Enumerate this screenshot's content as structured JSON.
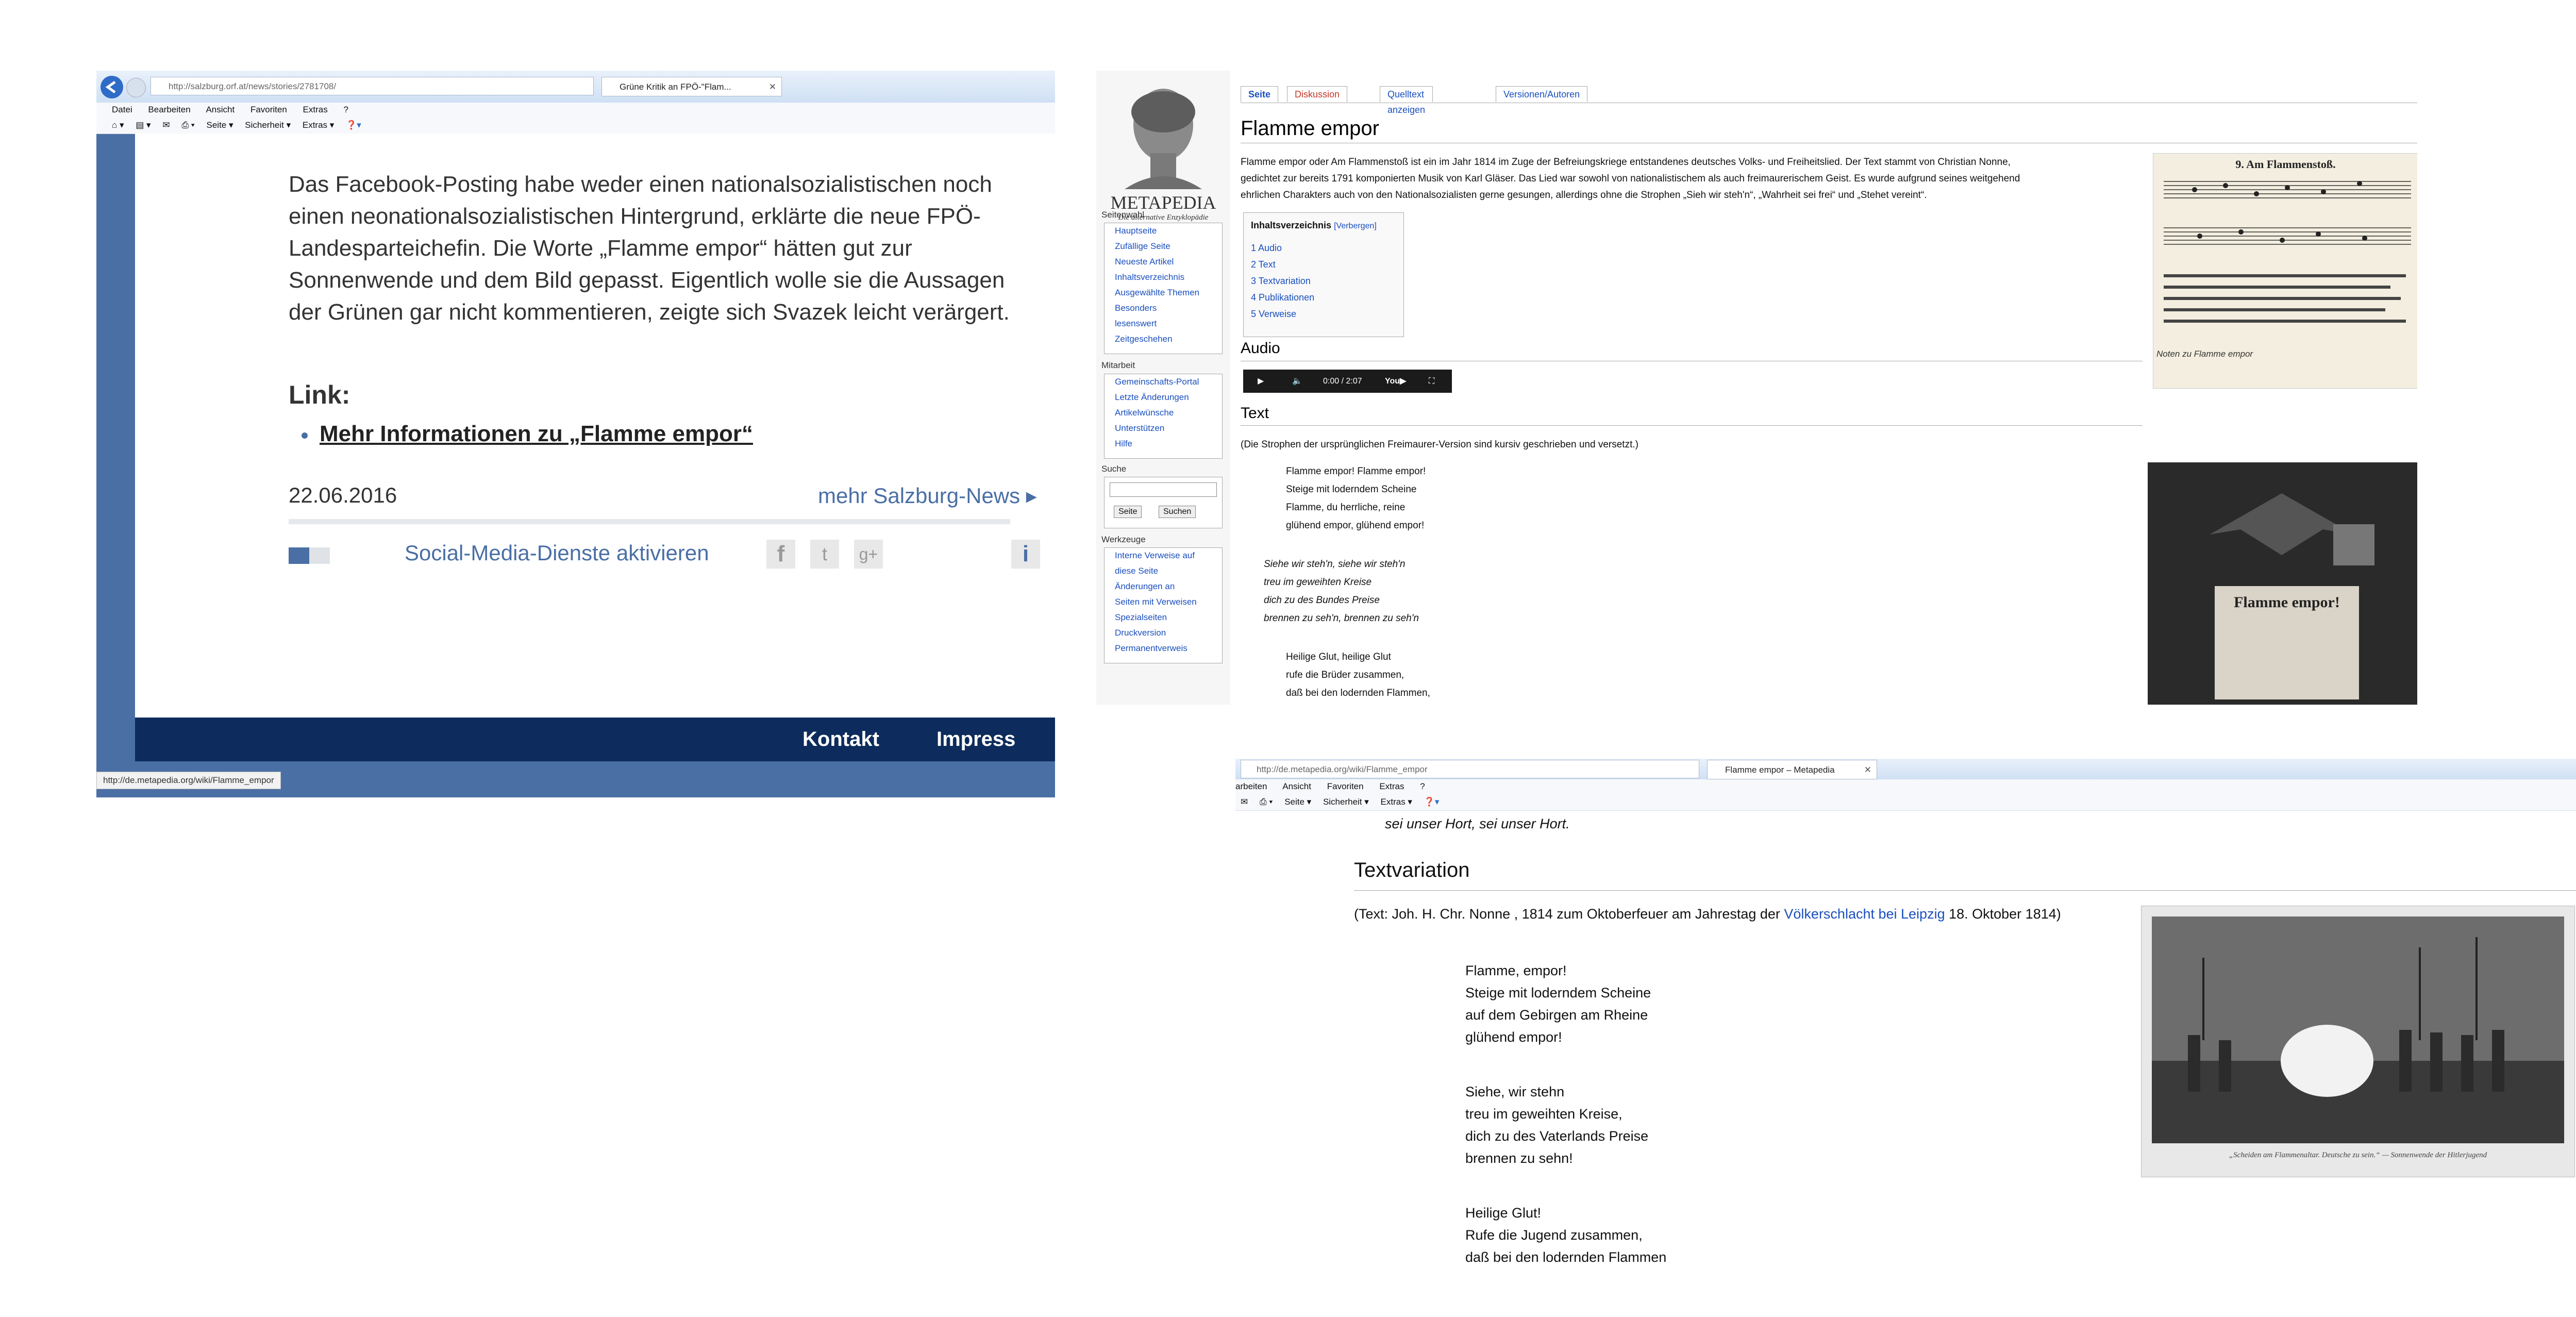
{
  "orf": {
    "url": "http://salzburg.orf.at/news/stories/2781708/",
    "tab_title": "Grüne Kritik an FPÖ-\"Flam...",
    "menu": [
      "Datei",
      "Bearbeiten",
      "Ansicht",
      "Favoriten",
      "Extras",
      "?"
    ],
    "commands": [
      "Seite ▾",
      "Sicherheit ▾",
      "Extras ▾"
    ],
    "paragraph": "Das Facebook-Posting habe weder einen nationalsozialistischen noch einen neonationalsozialistischen Hintergrund, erklärte die neue FPÖ-Landesparteichefin. Die Worte „Flamme empor“ hätten gut zur Sonnenwende und dem Bild gepasst. Eigentlich wolle sie die Aussagen der Grünen gar nicht kommentieren, zeigte sich Svazek leicht verärgert.",
    "link_heading": "Link:",
    "link_text": "Mehr Informationen zu „Flamme empor“",
    "date": "22.06.2016",
    "more_news": "mehr Salzburg-News ▸",
    "social_label": "Social-Media-Dienste aktivieren",
    "footer_kontakt": "Kontakt",
    "footer_impressum": "Impress",
    "status_url": "http://de.metapedia.org/wiki/Flamme_empor"
  },
  "metapedia": {
    "logo_text": "METAPEDIA",
    "logo_sub": "Die alternative Enzyklopädie",
    "tabs": [
      "Seite",
      "Diskussion",
      "Quelltext anzeigen",
      "Versionen/Autoren"
    ],
    "title": "Flamme empor",
    "side_seitenwahl_title": "Seitenwahl",
    "side_seitenwahl": [
      "Hauptseite",
      "Zufällige Seite",
      "Neueste Artikel",
      "Inhaltsverzeichnis",
      "Ausgewählte Themen",
      "Besonders",
      "lesenswert",
      "Zeitgeschehen"
    ],
    "side_mitarbeit_title": "Mitarbeit",
    "side_mitarbeit": [
      "Gemeinschafts-Portal",
      "Letzte Änderungen",
      "Artikelwünsche",
      "Unterstützen",
      "Hilfe"
    ],
    "side_suche_title": "Suche",
    "search_btn_seite": "Seite",
    "search_btn_suchen": "Suchen",
    "side_werkzeuge_title": "Werkzeuge",
    "side_werkzeuge": [
      "Interne Verweise auf",
      "diese Seite",
      "Änderungen an",
      "Seiten mit Verweisen",
      "Spezialseiten",
      "Druckversion",
      "Permanentverweis"
    ],
    "intro_1": "Flamme empor oder Am Flammenstoß ist ein im Jahr 1814 im Zuge der Befreiungskriege entstandenes deutsches Volks- und Freiheitslied. Der Text stammt von Christian Nonne,",
    "intro_2": "gedichtet zur bereits 1791 komponierten Musik von Karl Gläser. Das Lied war sowohl von nationalistischem als auch freimaurerischem Geist. Es wurde aufgrund seines weitgehend",
    "intro_3": "ehrlichen Charakters auch von den Nationalsozialisten gerne gesungen, allerdings ohne die Strophen „Sieh wir steh'n“, „Wahrheit sei frei“ und „Stehet vereint“.",
    "toc_title": "Inhaltsverzeichnis",
    "toc_hide": "[Verbergen]",
    "toc": [
      "1 Audio",
      "2 Text",
      "3 Textvariation",
      "4 Publikationen",
      "5 Verweise"
    ],
    "h_audio": "Audio",
    "audio_time": "0:00 / 2:07",
    "h_text": "Text",
    "text_note": "(Die Strophen der ursprünglichen Freimaurer-Version sind kursiv geschrieben und versetzt.)",
    "verse1": [
      "Flamme empor! Flamme empor!",
      "Steige mit loderndem Scheine",
      "Flamme, du herrliche, reine",
      "glühend empor, glühend empor!"
    ],
    "verse2": [
      "Siehe wir steh'n, siehe wir steh'n",
      "treu im geweihten Kreise",
      "dich zu des Bundes Preise",
      "brennen zu seh'n, brennen zu seh'n"
    ],
    "verse3": [
      "Heilige Glut, heilige Glut",
      "rufe die Brüder zusammen,",
      "daß bei den lodernden Flammen,"
    ],
    "img1_caption": "Noten zu Flamme empor",
    "img1_heading": "9. Am Flammenstoß.",
    "img2_title": "Flamme empor!"
  },
  "metapedia2": {
    "url": "http://de.metapedia.org/wiki/Flamme_empor",
    "tab_title": "Flamme empor – Metapedia",
    "menu": [
      "arbeiten",
      "Ansicht",
      "Favoriten",
      "Extras",
      "?"
    ],
    "commands": [
      "Seite ▾",
      "Sicherheit ▾",
      "Extras ▾"
    ],
    "prev_line": "sei unser Hort, sei unser Hort.",
    "h_textvariation": "Textvariation",
    "source_pre": "(Text: Joh. H. Chr. Nonne , 1814 zum Oktoberfeuer am Jahrestag der ",
    "source_link": "Völkerschlacht bei Leipzig",
    "source_post": " 18. Oktober 1814)",
    "verse1": [
      "Flamme, empor!",
      "Steige mit loderndem Scheine",
      "auf dem Gebirgen am Rheine",
      "glühend empor!"
    ],
    "verse2": [
      "Siehe, wir stehn",
      "treu im geweihten Kreise,",
      "dich zu des Vaterlands Preise",
      "brennen zu sehn!"
    ],
    "verse3": [
      "Heilige Glut!",
      "Rufe die Jugend zusammen,",
      "daß bei den lodernden Flammen"
    ],
    "photo_caption": "„Scheiden am Flammenaltar. Deutsche zu sein.“ — Sonnenwende der Hitlerjugend"
  }
}
